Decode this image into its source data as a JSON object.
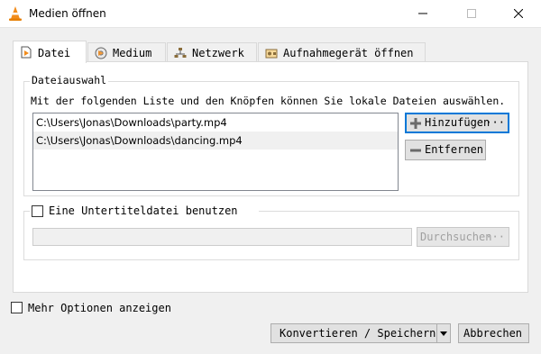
{
  "window": {
    "title": "Medien öffnen",
    "icon": "vlc-cone-icon",
    "controls": [
      "minimize-icon",
      "maximize-icon",
      "close-icon"
    ]
  },
  "tabs": [
    {
      "label": "Datei",
      "icon": "file-icon",
      "active": true
    },
    {
      "label": "Medium",
      "icon": "disc-icon",
      "active": false
    },
    {
      "label": "Netzwerk",
      "icon": "network-icon",
      "active": false
    },
    {
      "label": "Aufnahmegerät öffnen",
      "icon": "capture-device-icon",
      "active": false
    }
  ],
  "file_selection": {
    "group_title": "Dateiauswahl",
    "description": "Mit der folgenden Liste und den Knöpfen können Sie lokale Dateien auswählen.",
    "files": [
      "C:\\Users\\Jonas\\Downloads\\party.mp4",
      "C:\\Users\\Jonas\\Downloads\\dancing.mp4"
    ],
    "add_button": "Hinzufügen",
    "add_button_dots": "···",
    "remove_button": "Entfernen"
  },
  "subtitle": {
    "checkbox_label": "Eine Untertiteldatei benutzen",
    "checked": false,
    "file_value": "",
    "browse_button": "Durchsuchen",
    "browse_button_dots": "···"
  },
  "options": {
    "more_options_label": "Mehr Optionen anzeigen",
    "checked": false
  },
  "footer": {
    "convert_button": "Konvertieren / Speichern",
    "cancel_button": "Abbrechen"
  },
  "colors": {
    "accent": "#0078d7",
    "vlc_orange": "#f28c1c",
    "add_icon": "#6b6b6b",
    "window_bg": "#f0f0f0"
  }
}
